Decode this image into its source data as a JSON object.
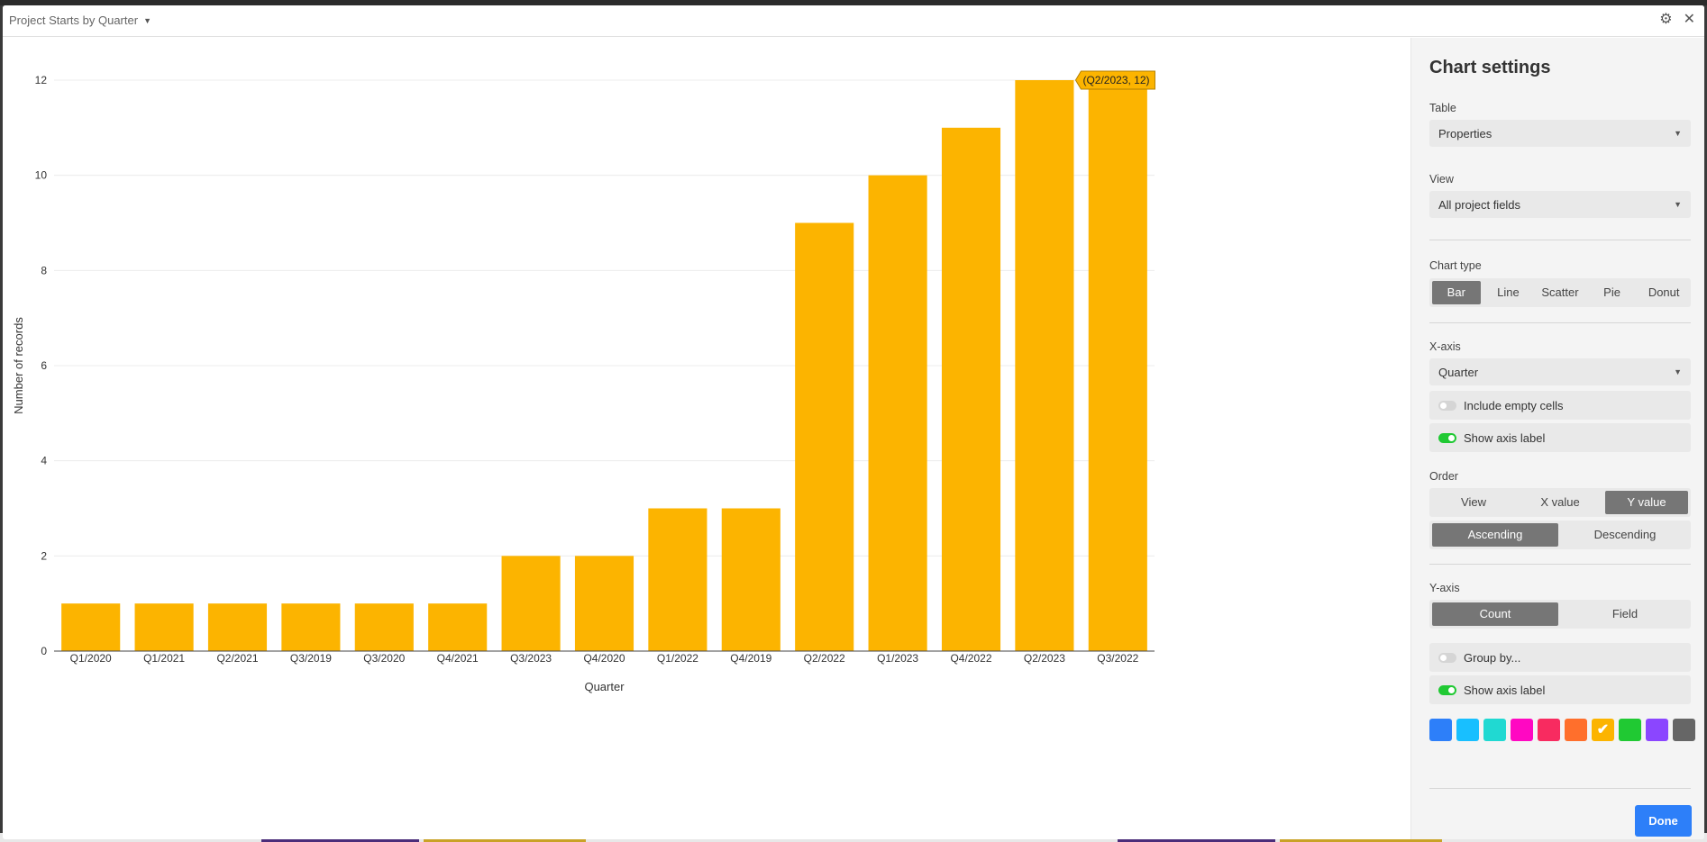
{
  "header": {
    "title": "Project Starts by Quarter",
    "caret_icon": "chevron-down-icon",
    "settings_icon": "gear-icon",
    "close_icon": "close-icon"
  },
  "panel": {
    "title": "Chart settings",
    "table_label": "Table",
    "table_value": "Properties",
    "view_label": "View",
    "view_value": "All project fields",
    "chart_type_label": "Chart type",
    "chart_types": [
      "Bar",
      "Line",
      "Scatter",
      "Pie",
      "Donut"
    ],
    "chart_type_selected": "Bar",
    "xaxis_label": "X-axis",
    "xaxis_value": "Quarter",
    "include_empty_label": "Include empty cells",
    "include_empty_on": false,
    "x_show_axis_label": "Show axis label",
    "x_show_axis_on": true,
    "order_label": "Order",
    "order_by": [
      "View",
      "X value",
      "Y value"
    ],
    "order_by_selected": "Y value",
    "order_dir": [
      "Ascending",
      "Descending"
    ],
    "order_dir_selected": "Ascending",
    "yaxis_label": "Y-axis",
    "yaxis_modes": [
      "Count",
      "Field"
    ],
    "yaxis_mode_selected": "Count",
    "group_by_label": "Group by...",
    "group_by_on": false,
    "y_show_axis_label": "Show axis label",
    "y_show_axis_on": true,
    "colors": [
      "#2d7ff9",
      "#18bfff",
      "#20d9d2",
      "#ff08c2",
      "#f82b60",
      "#ff6f2c",
      "#fcb400",
      "#20c933",
      "#8b46ff",
      "#666666"
    ],
    "selected_color": "#fcb400",
    "check_glyph": "✔",
    "done_label": "Done"
  },
  "chart_data": {
    "type": "bar",
    "categories": [
      "Q1/2020",
      "Q1/2021",
      "Q2/2021",
      "Q3/2019",
      "Q3/2020",
      "Q4/2021",
      "Q3/2023",
      "Q4/2020",
      "Q1/2022",
      "Q4/2019",
      "Q2/2022",
      "Q1/2023",
      "Q4/2022",
      "Q2/2023",
      "Q3/2022"
    ],
    "values": [
      1,
      1,
      1,
      1,
      1,
      1,
      2,
      2,
      3,
      3,
      9,
      10,
      11,
      12,
      12
    ],
    "xlabel": "Quarter",
    "ylabel": "Number of records",
    "ylim": [
      0,
      12
    ],
    "yticks": [
      0,
      2,
      4,
      6,
      8,
      10,
      12
    ],
    "grid": true,
    "color": "#fcb400",
    "tooltip": "(Q2/2023, 12)"
  }
}
